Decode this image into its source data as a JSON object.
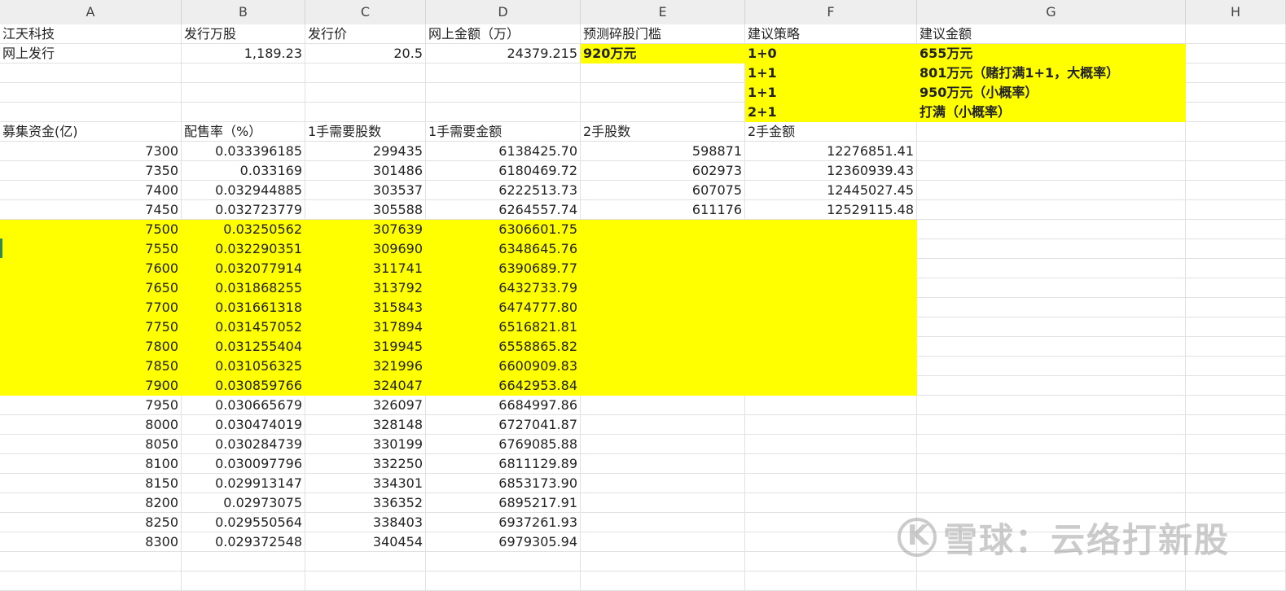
{
  "columns": [
    "A",
    "B",
    "C",
    "D",
    "E",
    "F",
    "G",
    "H"
  ],
  "header_rows": [
    [
      "江天科技",
      "发行万股",
      "发行价",
      "网上金额（万）",
      "预测碎股门槛",
      "建议策略",
      "建议金额",
      ""
    ],
    [
      "网上发行",
      "1,189.23",
      "20.5",
      "24379.215",
      "920万元",
      "1+0",
      "655万元",
      ""
    ],
    [
      "",
      "",
      "",
      "",
      "",
      "1+1",
      "801万元（赌打满1+1，大概率）",
      ""
    ],
    [
      "",
      "",
      "",
      "",
      "",
      "1+1",
      "950万元（小概率）",
      ""
    ],
    [
      "",
      "",
      "",
      "",
      "",
      "2+1",
      "打满（小概率）",
      ""
    ],
    [
      "募集资金(亿)",
      "配售率（%）",
      "1手需要股数",
      "1手需要金额",
      "2手股数",
      "2手金额",
      "",
      ""
    ]
  ],
  "data_rows": [
    [
      "7300",
      "0.033396185",
      "299435",
      "6138425.70",
      "598871",
      "12276851.41"
    ],
    [
      "7350",
      "0.033169",
      "301486",
      "6180469.72",
      "602973",
      "12360939.43"
    ],
    [
      "7400",
      "0.032944885",
      "303537",
      "6222513.73",
      "607075",
      "12445027.45"
    ],
    [
      "7450",
      "0.032723779",
      "305588",
      "6264557.74",
      "611176",
      "12529115.48"
    ],
    [
      "7500",
      "0.03250562",
      "307639",
      "6306601.75",
      "",
      ""
    ],
    [
      "7550",
      "0.032290351",
      "309690",
      "6348645.76",
      "",
      ""
    ],
    [
      "7600",
      "0.032077914",
      "311741",
      "6390689.77",
      "",
      ""
    ],
    [
      "7650",
      "0.031868255",
      "313792",
      "6432733.79",
      "",
      ""
    ],
    [
      "7700",
      "0.031661318",
      "315843",
      "6474777.80",
      "",
      ""
    ],
    [
      "7750",
      "0.031457052",
      "317894",
      "6516821.81",
      "",
      ""
    ],
    [
      "7800",
      "0.031255404",
      "319945",
      "6558865.82",
      "",
      ""
    ],
    [
      "7850",
      "0.031056325",
      "321996",
      "6600909.83",
      "",
      ""
    ],
    [
      "7900",
      "0.030859766",
      "324047",
      "6642953.84",
      "",
      ""
    ],
    [
      "7950",
      "0.030665679",
      "326097",
      "6684997.86",
      "",
      ""
    ],
    [
      "8000",
      "0.030474019",
      "328148",
      "6727041.87",
      "",
      ""
    ],
    [
      "8050",
      "0.030284739",
      "330199",
      "6769085.88",
      "",
      ""
    ],
    [
      "8100",
      "0.030097796",
      "332250",
      "6811129.89",
      "",
      ""
    ],
    [
      "8150",
      "0.029913147",
      "334301",
      "6853173.90",
      "",
      ""
    ],
    [
      "8200",
      "0.02973075",
      "336352",
      "6895217.91",
      "",
      ""
    ],
    [
      "8250",
      "0.029550564",
      "338403",
      "6937261.93",
      "",
      ""
    ],
    [
      "8300",
      "0.029372548",
      "340454",
      "6979305.94",
      "",
      ""
    ]
  ],
  "highlight_color": "#ffff00",
  "watermark": {
    "logo": "xueqiu-logo-icon",
    "text": "雪球：云络打新股"
  }
}
